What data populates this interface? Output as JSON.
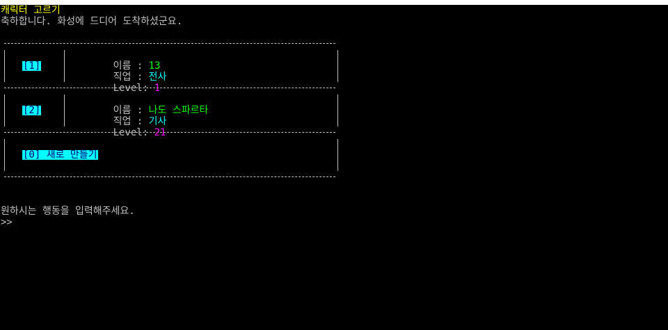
{
  "screen": {
    "title": "캐릭터 고르기",
    "intro": "축하합니다. 화성에 드디어 도착하셨군요.",
    "prompt": "원하시는 행동을 입력해주세요.",
    "input_marker": ">>"
  },
  "characters": [
    {
      "slot": "[1]",
      "name_label": "이름",
      "name": "13",
      "job_label": "직업",
      "job": "전사",
      "level_label": "Level",
      "level": "1"
    },
    {
      "slot": "[2]",
      "name_label": "이름",
      "name": "나도 스파르타",
      "job_label": "직업",
      "job": "기사",
      "level_label": "Level",
      "level": "21"
    }
  ],
  "new_character": {
    "label": "[0] 새로 만들기"
  },
  "colors": {
    "title": "#ffff00",
    "name_value": "#00ff00",
    "job_value": "#00ffff",
    "level_value": "#ff00ff",
    "button_bg": "#00ffff",
    "button_fg": "#000080"
  }
}
